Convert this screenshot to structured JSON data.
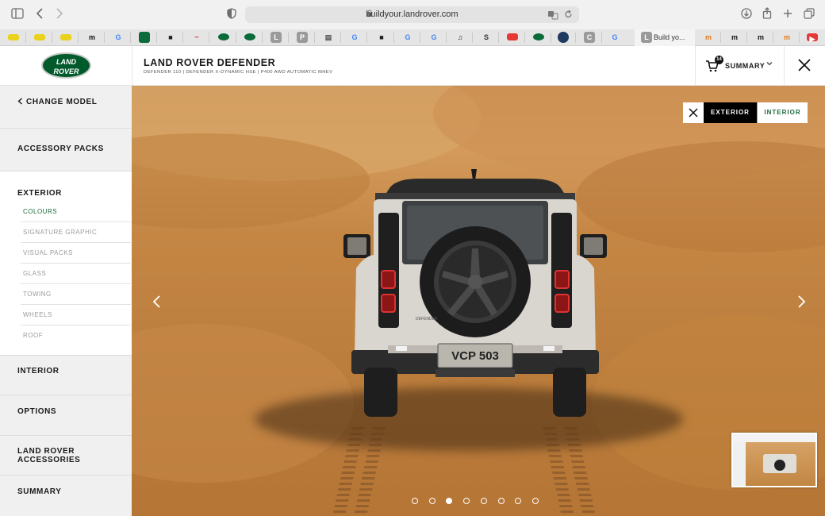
{
  "browser": {
    "url": "buildyour.landrover.com",
    "active_tab_title": "Build yo..."
  },
  "header": {
    "logo_line1": "LAND",
    "logo_line2": "ROVER",
    "model_title": "LAND ROVER DEFENDER",
    "model_subtitle": "DEFENDER 110 | DEFENDER X-DYNAMIC HSE | P400 AWD AUTOMATIC MHEV",
    "cart_count": "14",
    "summary_label": "SUMMARY"
  },
  "sidebar": {
    "change_model": "CHANGE MODEL",
    "accessory_packs": "ACCESSORY PACKS",
    "exterior": "EXTERIOR",
    "exterior_items": [
      {
        "label": "COLOURS",
        "active": true
      },
      {
        "label": "SIGNATURE GRAPHIC",
        "active": false
      },
      {
        "label": "VISUAL PACKS",
        "active": false
      },
      {
        "label": "GLASS",
        "active": false
      },
      {
        "label": "TOWING",
        "active": false
      },
      {
        "label": "WHEELS",
        "active": false
      },
      {
        "label": "ROOF",
        "active": false
      }
    ],
    "interior": "INTERIOR",
    "options": "OPTIONS",
    "accessories_line1": "LAND ROVER",
    "accessories_line2": "ACCESSORIES",
    "summary": "SUMMARY"
  },
  "viewer": {
    "exterior_label": "EXTERIOR",
    "interior_label": "INTERIOR",
    "plate": "VCP 503",
    "badge": "DEFENDER",
    "carousel_total": 8,
    "carousel_active": 3
  },
  "colors": {
    "brand_green": "#005a2b",
    "accent_green": "#1d6b3d",
    "sand": "#c58644"
  },
  "icons": {
    "sidebar_toggle": "sidebar-icon",
    "back": "chevron-left-icon",
    "forward": "chevron-right-icon",
    "shield": "shield-icon",
    "download": "download-icon",
    "share": "share-icon",
    "new_tab": "plus-icon",
    "tabs": "tabs-icon",
    "cart": "cart-icon",
    "close": "close-icon"
  }
}
